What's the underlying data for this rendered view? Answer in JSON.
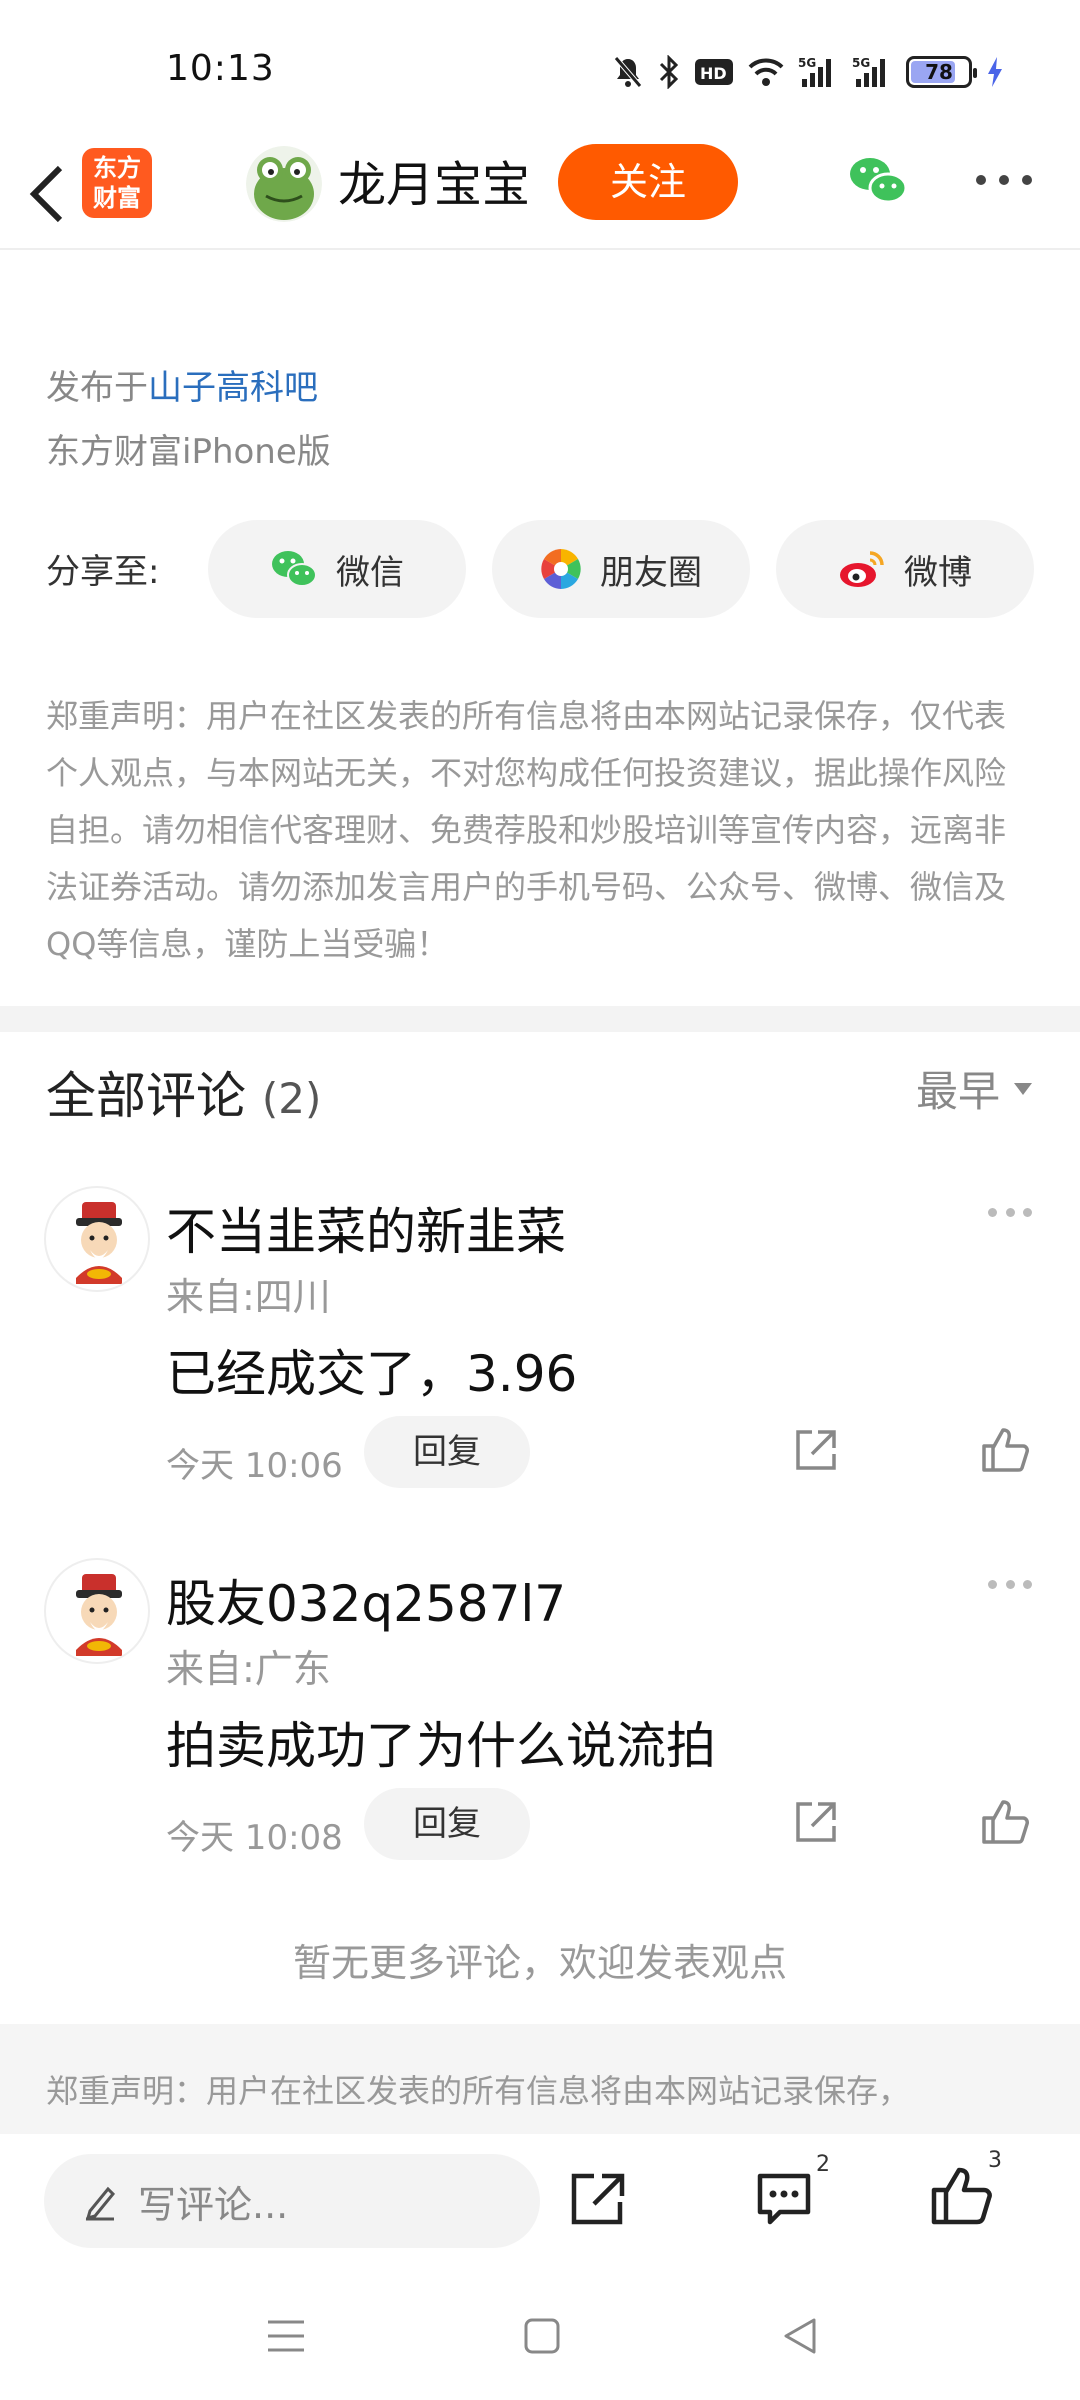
{
  "status_bar": {
    "time": "10:13",
    "battery_level": "78",
    "battery_fraction": 0.78,
    "icons": [
      "mute-icon",
      "bluetooth-icon",
      "hd-icon",
      "wifi-icon",
      "signal-5g-icon",
      "signal-5g-icon",
      "battery-icon",
      "charging-icon"
    ]
  },
  "nav": {
    "logo_text_line1": "东方",
    "logo_text_line2": "财富",
    "author_name": "龙月宝宝",
    "follow_label": "关注"
  },
  "post": {
    "published_prefix": "发布于",
    "forum_name": "山子高科吧",
    "client": "东方财富iPhone版"
  },
  "share": {
    "label": "分享至:",
    "buttons": [
      {
        "label": "微信",
        "icon": "wechat-icon"
      },
      {
        "label": "朋友圈",
        "icon": "moments-icon"
      },
      {
        "label": "微博",
        "icon": "weibo-icon"
      }
    ]
  },
  "disclaimer": "郑重声明：用户在社区发表的所有信息将由本网站记录保存，仅代表个人观点，与本网站无关，不对您构成任何投资建议，据此操作风险自担。请勿相信代客理财、免费荐股和炒股培训等宣传内容，远离非法证券活动。请勿添加发言用户的手机号码、公众号、微博、微信及QQ等信息，谨防上当受骗！",
  "comments_section": {
    "title": "全部评论",
    "count": "(2)",
    "sort_label": "最早",
    "reply_label": "回复",
    "items": [
      {
        "name": "不当韭菜的新韭菜",
        "from": "来自:四川",
        "text": "已经成交了，3.96",
        "time": "今天 10:06"
      },
      {
        "name": "股友032q2587l7",
        "from": "来自:广东",
        "text": "拍卖成功了为什么说流拍",
        "time": "今天 10:08"
      }
    ],
    "no_more": "暂无更多评论，欢迎发表观点"
  },
  "bottom_disclaimer": "郑重声明：用户在社区发表的所有信息将由本网站记录保存，",
  "action_bar": {
    "input_placeholder": "写评论...",
    "comment_count": "2",
    "like_count": "3"
  },
  "colors": {
    "accent": "#ff5a00",
    "link": "#2a6ebd",
    "wechat": "#3fc25b"
  }
}
